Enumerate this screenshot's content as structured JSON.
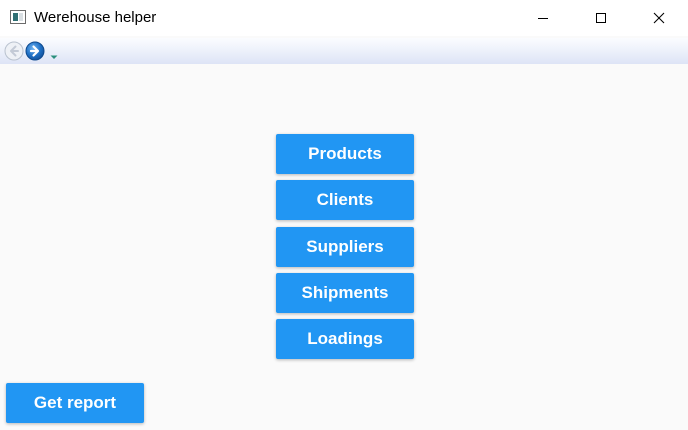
{
  "window": {
    "title": "Werehouse helper",
    "icon": "app-window-icon",
    "controls": {
      "minimize_icon": "minimize-icon",
      "maximize_icon": "maximize-icon",
      "close_icon": "close-icon"
    }
  },
  "navigation": {
    "back_icon": "back-arrow-icon",
    "forward_icon": "forward-arrow-icon",
    "history_icon": "chevron-down-icon"
  },
  "menu": {
    "products_label": "Products",
    "clients_label": "Clients",
    "suppliers_label": "Suppliers",
    "shipments_label": "Shipments",
    "loadings_label": "Loadings"
  },
  "report": {
    "label": "Get report"
  },
  "colors": {
    "button_background": "#2196f3",
    "button_text": "#ffffff",
    "content_background": "#fafafa",
    "nav_arrow": "#1e6fc4"
  }
}
